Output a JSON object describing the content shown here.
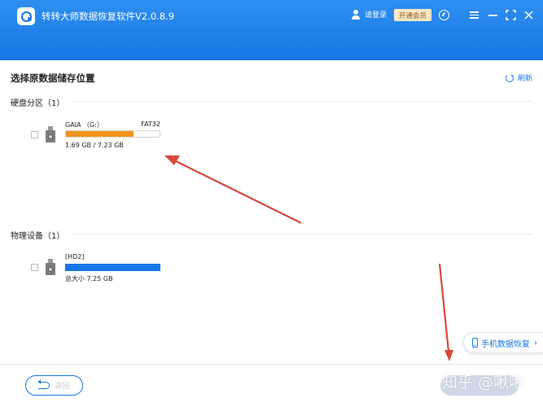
{
  "app": {
    "title": "转转大师数据恢复软件V2.0.8.9",
    "login_label": "请登录",
    "vip_label": "开通会员"
  },
  "main": {
    "section_title": "选择原数据储存位置",
    "refresh_label": "刷新"
  },
  "partitions": {
    "title": "硬盘分区（1）",
    "items": [
      {
        "name": "GAIA （G:）",
        "filesystem": "FAT32",
        "size_text": "1.69 GB / 7.23 GB",
        "used_fraction": 0.72,
        "bar_color": "#f0941e",
        "checked": false
      }
    ]
  },
  "devices": {
    "title": "物理设备（1）",
    "items": [
      {
        "name": "[HD2]",
        "size_text": "总大小 7.25 GB",
        "used_fraction": 1.0,
        "bar_color": "#1677e6",
        "checked": false
      }
    ]
  },
  "floating": {
    "mobile_recovery_label": "手机数据恢复"
  },
  "footer": {
    "back_label": "返回"
  },
  "watermark": "知乎 @啾啾",
  "colors": {
    "titlebar": "#1677e6",
    "accent": "#1677e6",
    "arrow": "#d9483b"
  }
}
